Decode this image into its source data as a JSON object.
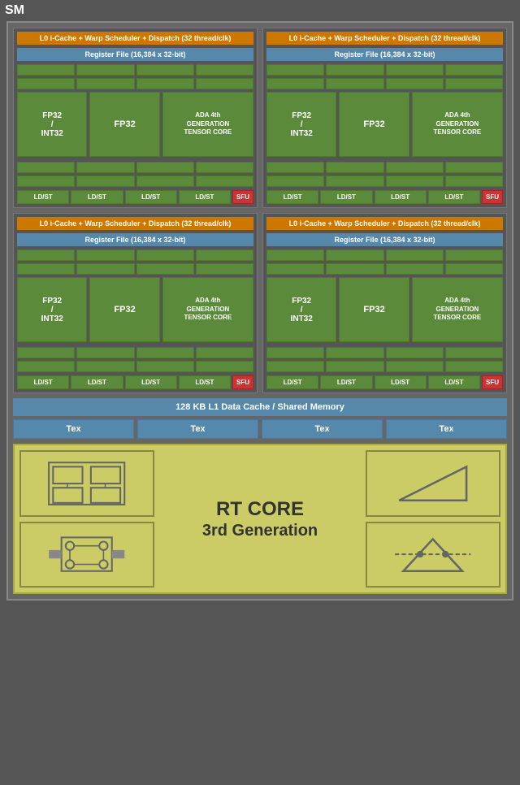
{
  "title": "SM",
  "warp_header": "L0 i-Cache + Warp Scheduler + Dispatch (32 thread/clk)",
  "register_file": "Register File (16,384 x 32-bit)",
  "fp32_int32": "FP32\n/\nINT32",
  "fp32": "FP32",
  "tensor_core": "ADA 4th\nGENERATION\nTENSOR CORE",
  "ldst": "LD/ST",
  "sfu": "SFU",
  "l1_cache": "128 KB L1 Data Cache / Shared Memory",
  "tex": "Tex",
  "rt_core_title": "RT CORE",
  "rt_core_sub": "3rd Generation",
  "colors": {
    "orange": "#cc7700",
    "teal": "#5588aa",
    "green": "#5a8a3a",
    "red": "#cc3333",
    "yellow_bg": "#cccc66",
    "gray_bg": "#666666"
  }
}
